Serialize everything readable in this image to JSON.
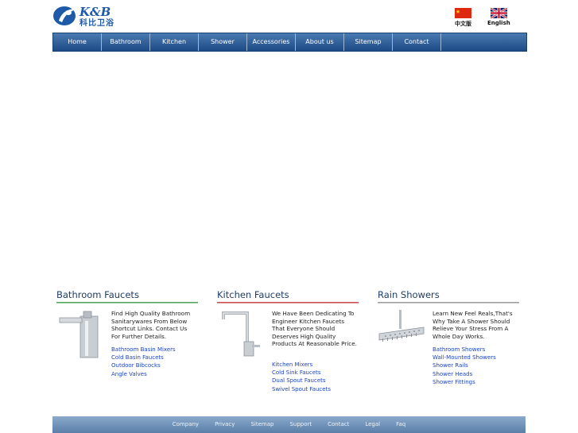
{
  "brand": {
    "name": "K&B",
    "cn_name": "科比卫浴"
  },
  "languages": [
    {
      "label": "中文版",
      "flag": "china-flag"
    },
    {
      "label": "English",
      "flag": "uk-flag"
    }
  ],
  "nav": [
    "Home",
    "Bathroom",
    "Kitchen",
    "Shower",
    "Accessories",
    "About us",
    "Sitemap",
    "Contact"
  ],
  "sections": [
    {
      "title": "Bathroom Faucets",
      "rule_color": "#2e8b3c",
      "description": "Find High Quality Bathroom Sanitarywares From Below Shortcut Links. Contact Us For Further Details.",
      "links": [
        "Bathroom Basin Mixers",
        "Cold Basin Faucets",
        "Outdoor Bibcocks",
        "Angle Valves"
      ]
    },
    {
      "title": "Kitchen Faucets",
      "rule_color": "#c0272d",
      "description": "We Have Been Dedicating To Engineer Kitchen Faucets That Everyone Should Deserves High Quality Products At Reasonable Price.",
      "links": [
        "Kitchen Mixers",
        "Cold Sink Faucets",
        "Dual Spout Faucets",
        "Swivel Spout Faucets"
      ]
    },
    {
      "title": "Rain Showers",
      "rule_color": "#8a8a8a",
      "description": "Learn New Feel Reals,That's Why Take A Shower Should Relieve Your Stress From A Whole Day Works.",
      "links": [
        "Bathroom Showers",
        "Wall-Mounted Showers",
        "Shower Rails",
        "Shower Heads",
        "Shower Fittings"
      ]
    }
  ],
  "footer": [
    "Company",
    "Privacy",
    "Sitemap",
    "Support",
    "Contact",
    "Legal",
    "Faq"
  ],
  "colors": {
    "nav_top": "#4a7ab2",
    "nav_bottom": "#1d4a85",
    "link": "#1a44c8",
    "heading": "#1f3e66"
  }
}
